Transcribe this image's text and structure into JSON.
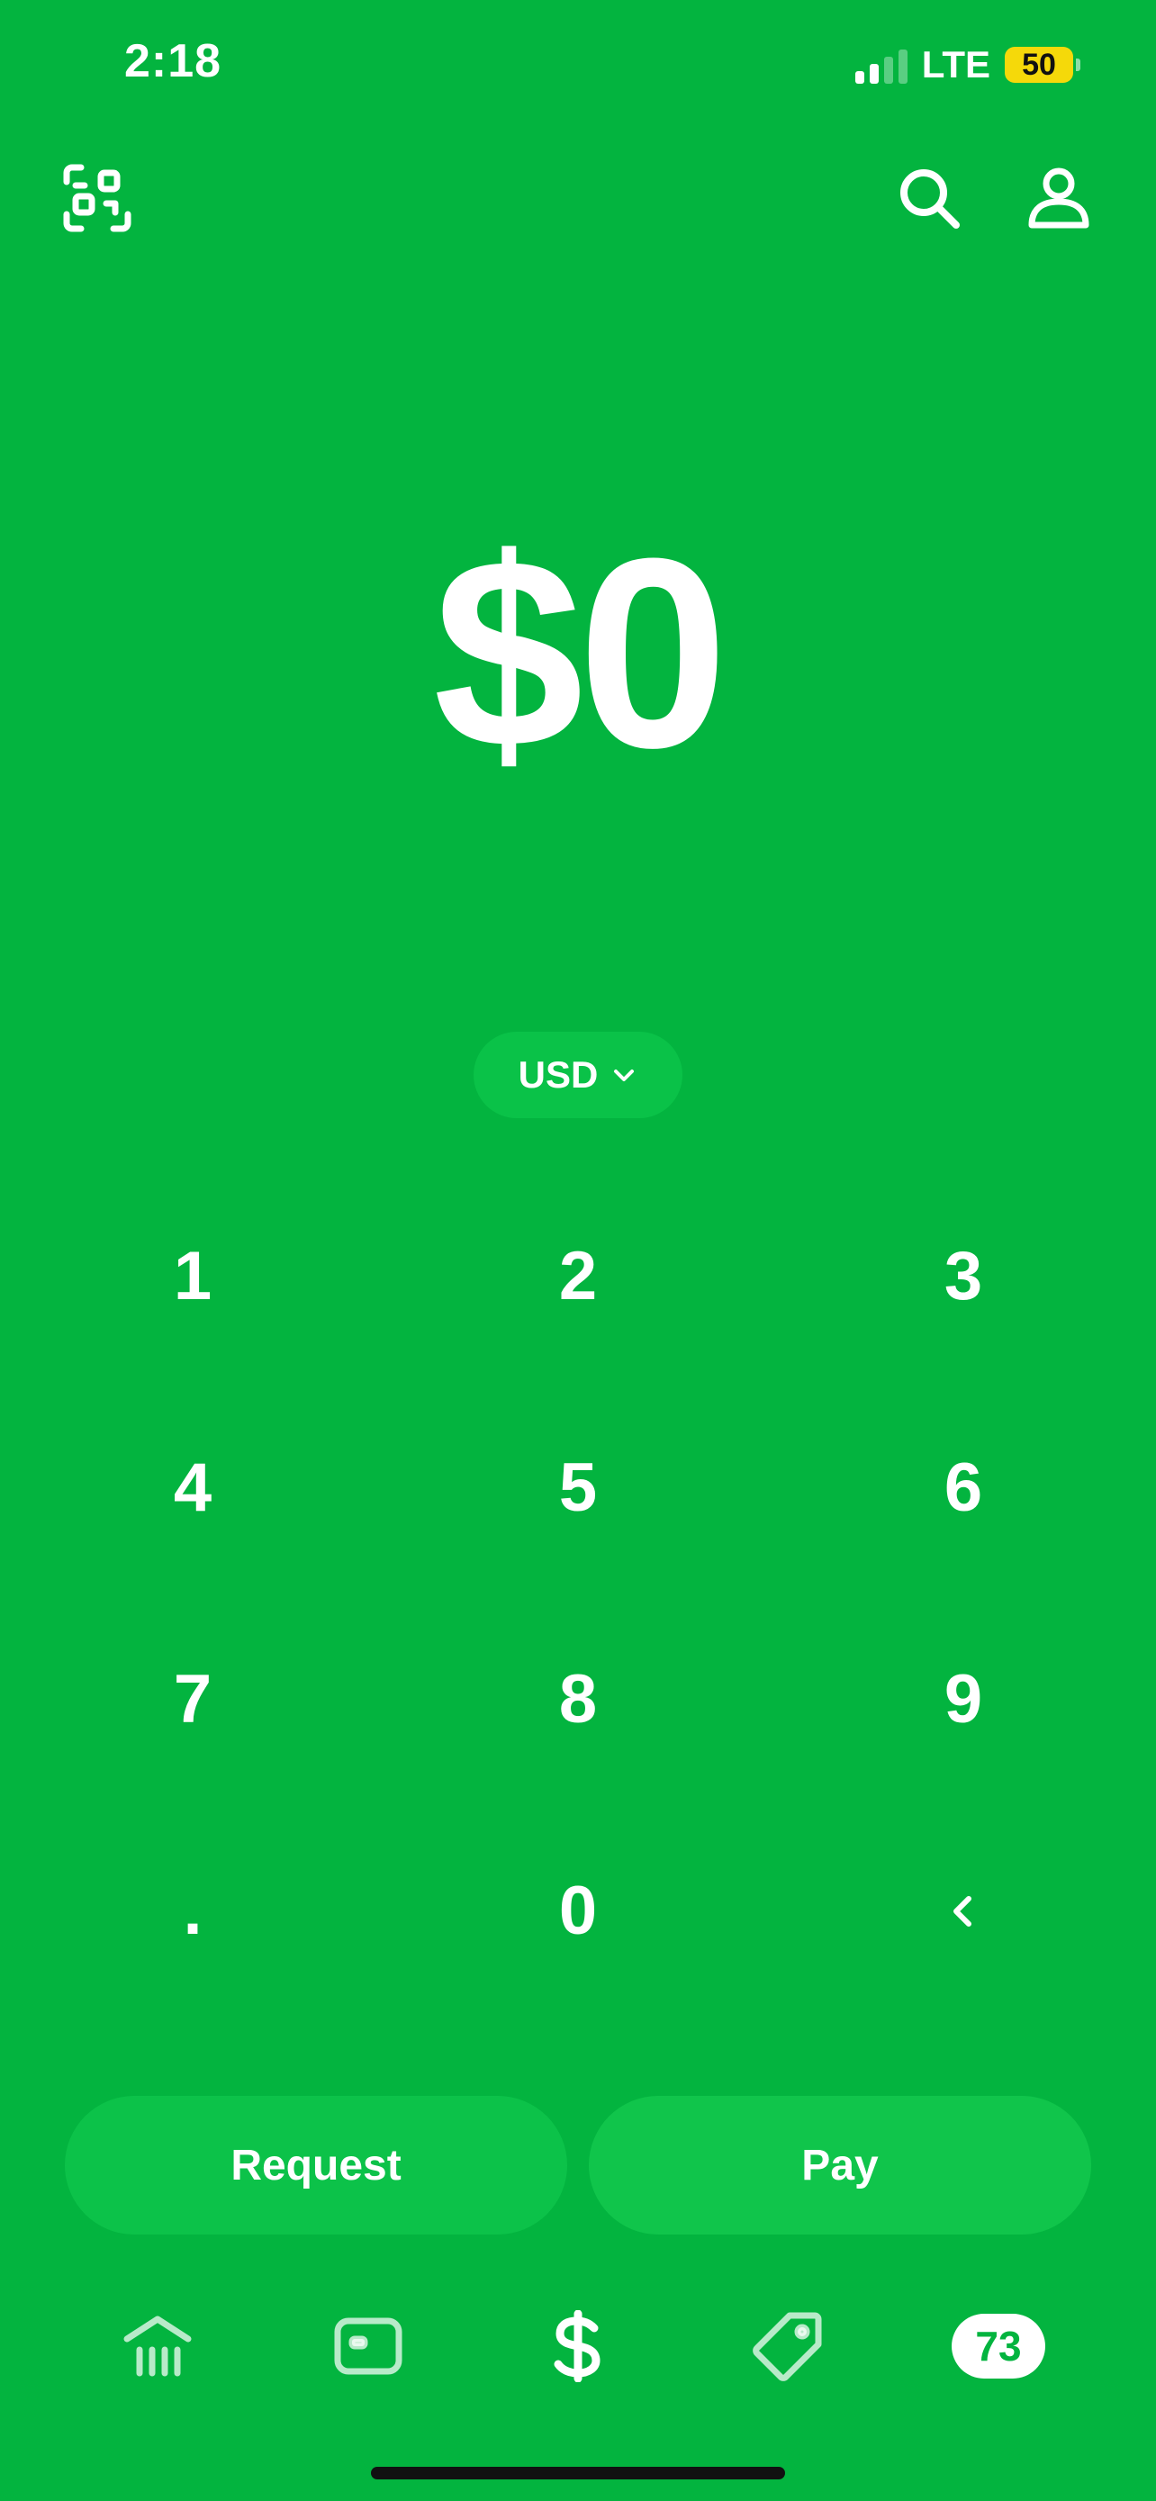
{
  "status_bar": {
    "time": "2:18",
    "network": "LTE",
    "battery": "50"
  },
  "amount": {
    "display": "$0"
  },
  "currency": {
    "selected": "USD"
  },
  "keypad": {
    "keys": [
      "1",
      "2",
      "3",
      "4",
      "5",
      "6",
      "7",
      "8",
      "9",
      ".",
      "0",
      "<"
    ]
  },
  "actions": {
    "request_label": "Request",
    "pay_label": "Pay"
  },
  "nav": {
    "items": [
      {
        "icon": "bank-icon"
      },
      {
        "icon": "card-icon"
      },
      {
        "icon": "dollar-icon"
      },
      {
        "icon": "tag-icon"
      },
      {
        "badge": "73"
      }
    ]
  },
  "colors": {
    "background": "#03b43f",
    "battery": "#f5d90a",
    "text": "#ffffff"
  }
}
